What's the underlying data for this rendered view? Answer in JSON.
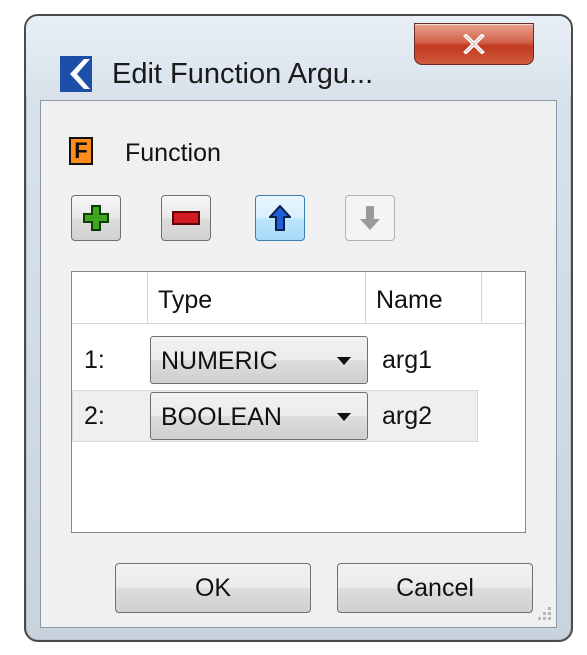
{
  "window": {
    "title": "Edit Function Argu...",
    "close_label": "X"
  },
  "section": {
    "icon_letter": "F",
    "label": "Function"
  },
  "toolbar": {
    "add_icon": "plus-icon",
    "remove_icon": "minus-icon",
    "up_icon": "arrow-up-icon",
    "down_icon": "arrow-down-icon"
  },
  "table": {
    "columns": [
      "Type",
      "Name"
    ],
    "rows": [
      {
        "index": "1:",
        "type": "NUMERIC",
        "name": "arg1"
      },
      {
        "index": "2:",
        "type": "BOOLEAN",
        "name": "arg2"
      }
    ]
  },
  "buttons": {
    "ok": "OK",
    "cancel": "Cancel"
  },
  "colors": {
    "add": "#3fa61f",
    "remove": "#c0151a",
    "up": "#1f5fd6",
    "down_disabled": "#9a9a9a",
    "close_red": "#c0391f",
    "fn_icon": "#ff8c1a"
  }
}
